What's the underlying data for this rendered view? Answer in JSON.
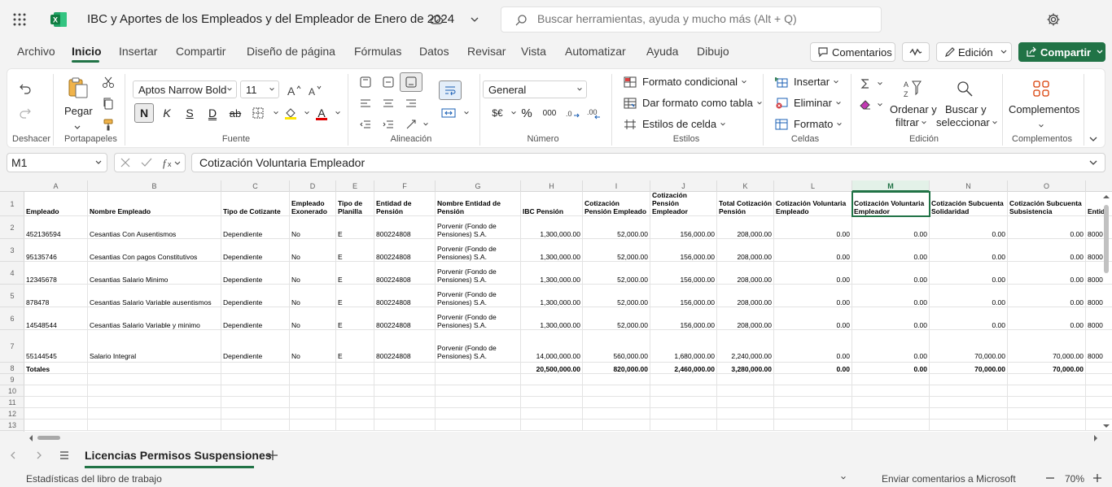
{
  "title": "IBC y Aportes de los Empleados y del Empleador de Enero de 2024",
  "search_placeholder": "Buscar herramientas, ayuda y mucho más (Alt + Q)",
  "menu": [
    "Archivo",
    "Inicio",
    "Insertar",
    "Compartir",
    "Diseño de página",
    "Fórmulas",
    "Datos",
    "Revisar",
    "Vista",
    "Automatizar",
    "Ayuda",
    "Dibujo"
  ],
  "top_buttons": {
    "comments": "Comentarios",
    "edit": "Edición",
    "share": "Compartir"
  },
  "ribbon": {
    "undo_label": "Deshacer",
    "paste": "Pegar",
    "clipboard_label": "Portapapeles",
    "font_name": "Aptos Narrow Bold",
    "font_size": "11",
    "font_label": "Fuente",
    "alignment_label": "Alineación",
    "number_format": "General",
    "number_label": "Número",
    "cond_format": "Formato condicional",
    "table_format": "Dar formato como tabla",
    "cell_styles": "Estilos de celda",
    "styles_label": "Estilos",
    "insert": "Insertar",
    "delete": "Eliminar",
    "format": "Formato",
    "cells_label": "Celdas",
    "sort1": "Ordenar y",
    "sort2": "filtrar",
    "find1": "Buscar y",
    "find2": "seleccionar",
    "edit_label": "Edición",
    "addins": "Complementos",
    "addins_label": "Complementos",
    "bold_glyph": "N",
    "italic_glyph": "K",
    "underline_glyph": "S",
    "double_underline_glyph": "D",
    "strike_glyph": "ab",
    "font_color_glyph": "A",
    "currency_glyph": "$€",
    "percent_glyph": "%",
    "thousands_glyph": "000"
  },
  "name_box": "M1",
  "formula": "Cotización Voluntaria Empleador",
  "columns": [
    "A",
    "B",
    "C",
    "D",
    "E",
    "F",
    "G",
    "H",
    "I",
    "J",
    "K",
    "L",
    "M",
    "N",
    "O"
  ],
  "header_row": [
    "Empleado",
    "Nombre Empleado",
    "Tipo de Cotizante",
    "Empleado Exonerado",
    "Tipo de Planilla",
    "Entidad de Pensión",
    "Nombre Entidad de Pensión",
    "IBC Pensión",
    "Cotización Pensión Empleado",
    "Cotización Pensión Empleador",
    "Total Cotización Pensión",
    "Cotización Voluntaria Empleado",
    "Cotización Voluntaria Empleador",
    "Cotización Subcuenta Solidaridad",
    "Cotización Subcuenta Subsistencia",
    "Entid"
  ],
  "rows": [
    [
      "452136594",
      "Cesantias Con Ausentismos",
      "Dependiente",
      "No",
      "E",
      "800224808",
      "Porvenir (Fondo de Pensiones) S.A.",
      "1,300,000.00",
      "52,000.00",
      "156,000.00",
      "208,000.00",
      "0.00",
      "0.00",
      "0.00",
      "0.00",
      "8000"
    ],
    [
      "95135746",
      "Cesantias Con pagos Constitutivos",
      "Dependiente",
      "No",
      "E",
      "800224808",
      "Porvenir (Fondo de Pensiones) S.A.",
      "1,300,000.00",
      "52,000.00",
      "156,000.00",
      "208,000.00",
      "0.00",
      "0.00",
      "0.00",
      "0.00",
      "8000"
    ],
    [
      "12345678",
      "Cesantias Salario Minimo",
      "Dependiente",
      "No",
      "E",
      "800224808",
      "Porvenir (Fondo de Pensiones) S.A.",
      "1,300,000.00",
      "52,000.00",
      "156,000.00",
      "208,000.00",
      "0.00",
      "0.00",
      "0.00",
      "0.00",
      "8000"
    ],
    [
      "878478",
      "Cesantias Salario Variable ausentismos",
      "Dependiente",
      "No",
      "E",
      "800224808",
      "Porvenir (Fondo de Pensiones) S.A.",
      "1,300,000.00",
      "52,000.00",
      "156,000.00",
      "208,000.00",
      "0.00",
      "0.00",
      "0.00",
      "0.00",
      "8000"
    ],
    [
      "14548544",
      "Cesantias Salario Variable y minimo",
      "Dependiente",
      "No",
      "E",
      "800224808",
      "Porvenir (Fondo de Pensiones) S.A.",
      "1,300,000.00",
      "52,000.00",
      "156,000.00",
      "208,000.00",
      "0.00",
      "0.00",
      "0.00",
      "0.00",
      "8000"
    ],
    [
      "55144545",
      "Salario Integral",
      "Dependiente",
      "No",
      "E",
      "800224808",
      "Porvenir (Fondo de Pensiones) S.A.",
      "14,000,000.00",
      "560,000.00",
      "1,680,000.00",
      "2,240,000.00",
      "0.00",
      "0.00",
      "70,000.00",
      "70,000.00",
      "8000"
    ]
  ],
  "totals_row": [
    "Totales",
    "",
    "",
    "",
    "",
    "",
    "",
    "20,500,000.00",
    "820,000.00",
    "2,460,000.00",
    "3,280,000.00",
    "0.00",
    "0.00",
    "70,000.00",
    "70,000.00",
    ""
  ],
  "row_numbers": [
    "1",
    "2",
    "3",
    "4",
    "5",
    "6",
    "7",
    "8",
    "9",
    "10",
    "11",
    "12",
    "13"
  ],
  "sheet_tab": "Licencias Permisos Suspensiones",
  "status": {
    "left": "Estadísticas del libro de trabajo",
    "feedback": "Enviar comentarios a Microsoft",
    "zoom": "70%"
  },
  "colors": {
    "accent": "#217346"
  }
}
